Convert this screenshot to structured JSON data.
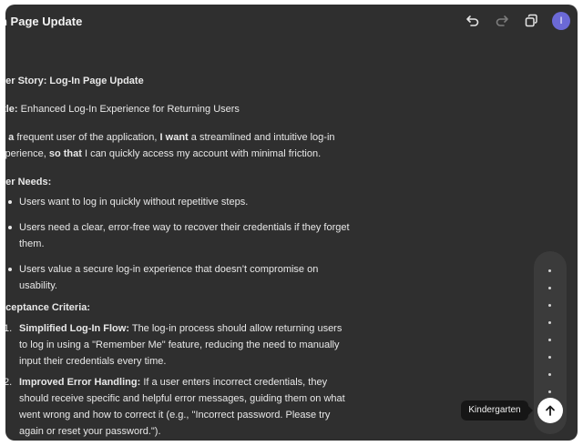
{
  "header": {
    "title": "n Page Update",
    "avatar_initial": "I",
    "avatar_color": "#6b69d6",
    "icons": [
      "undo-icon",
      "redo-icon",
      "copy-icon"
    ]
  },
  "document": {
    "story_heading": "ser Story: Log-In Page Update",
    "title_label": "itle:",
    "title_value": "Enhanced Log-In Experience for Returning Users",
    "statement": {
      "as_a": "s a",
      "role": "frequent user of the application,",
      "i_want": "I want",
      "want_text": "a streamlined and intuitive log-in",
      "line2_start": "xperience,",
      "so_that": "so that",
      "so_that_text": "I can quickly access my account with minimal friction."
    },
    "needs_heading": "ser Needs:",
    "needs": [
      "Users want to log in quickly without repetitive steps.",
      "Users need a clear, error-free way to recover their credentials if they forget them.",
      "Users value a secure log-in experience that doesn’t compromise on usability."
    ],
    "criteria_heading": "cceptance Criteria:",
    "criteria": [
      {
        "num": "1.",
        "lead": "Simplified Log-In Flow:",
        "text": "The log-in process should allow returning users to log in using a \"Remember Me\" feature, reducing the need to manually input their credentials every time."
      },
      {
        "num": "2.",
        "lead": "Improved Error Handling:",
        "text": "If a user enters incorrect credentials, they should receive specific and helpful error messages, guiding them on what went wrong and how to correct it (e.g., \"Incorrect password. Please try again or reset your password.\")."
      }
    ]
  },
  "tooltip": {
    "label": "Kindergarten"
  },
  "send_button": {
    "icon": "arrow-up-icon"
  }
}
